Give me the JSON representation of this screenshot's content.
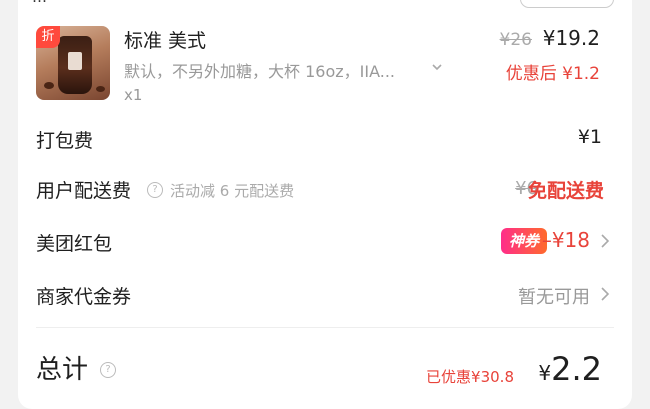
{
  "header": {
    "partial_text": "…",
    "pill_text": ""
  },
  "product": {
    "discount_tag": "折",
    "name": "标准 美式",
    "spec": "默认，不另外加糖，大杯 16oz，IIA...",
    "qty": "x1",
    "original_price": "¥26",
    "price": "¥19.2",
    "after_discount": "优惠后 ¥1.2"
  },
  "packing": {
    "label": "打包费",
    "value": "¥1"
  },
  "delivery": {
    "label": "用户配送费",
    "hint": "活动减 6 元配送费",
    "original": "¥6",
    "value": "免配送费"
  },
  "redpacket": {
    "label": "美团红包",
    "badge": "神券",
    "value": "–¥18"
  },
  "voucher": {
    "label": "商家代金券",
    "value": "暂无可用"
  },
  "total": {
    "label": "总计",
    "saved": "已优惠¥30.8",
    "currency": "¥",
    "value": "2.2"
  },
  "colors": {
    "accent": "#e8433a",
    "badge_start": "#ff2d8a",
    "badge_end": "#ff6a2c"
  },
  "icons": [
    "discount-tag",
    "chevron-down-icon",
    "question-icon",
    "chevron-right-icon"
  ]
}
